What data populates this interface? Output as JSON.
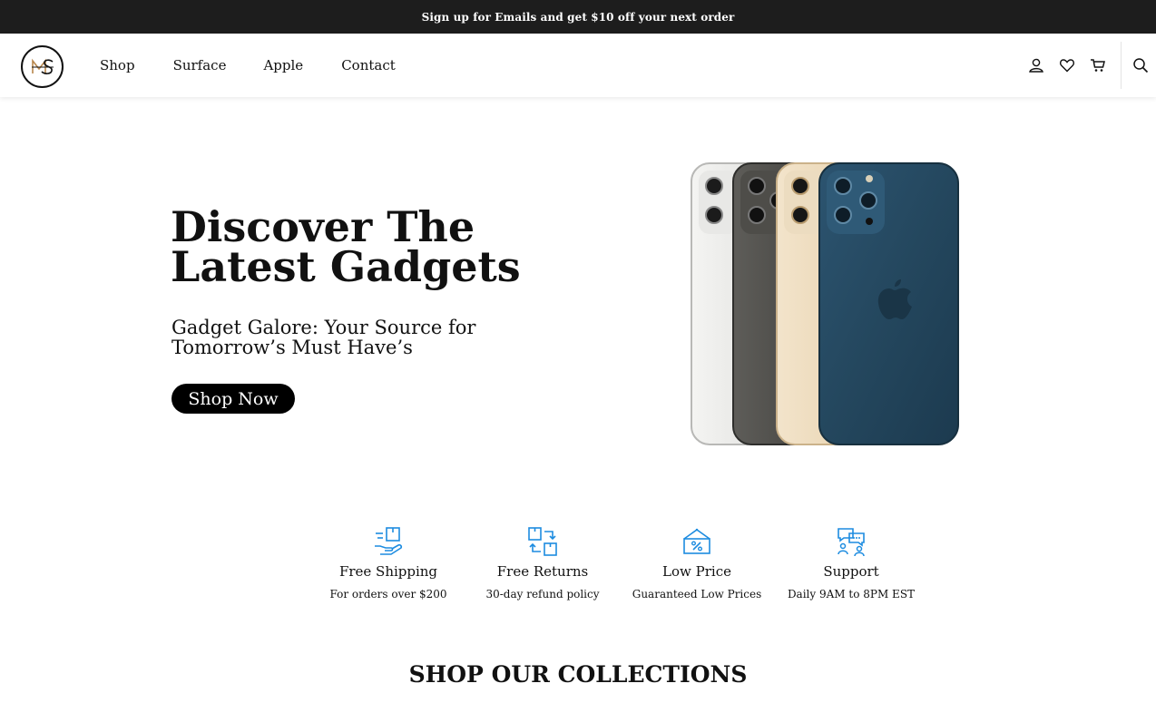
{
  "announcement": "Sign up for Emails and get $10 off your next order",
  "logo": {
    "letters": "MS",
    "accent": "#b8864b"
  },
  "nav": [
    "Shop",
    "Surface",
    "Apple",
    "Contact"
  ],
  "header_icons": [
    "account-icon",
    "wishlist-heart-icon",
    "cart-icon",
    "search-icon"
  ],
  "hero": {
    "title": "Discover The Latest Gadgets",
    "subtitle": "Gadget Galore: Your Source for Tomorrow’s Must Have’s",
    "cta": "Shop Now"
  },
  "features": [
    {
      "icon": "hand-box-icon",
      "title": "Free Shipping",
      "desc": "For orders over $200"
    },
    {
      "icon": "exchange-boxes-icon",
      "title": "Free Returns",
      "desc": "30-day refund policy"
    },
    {
      "icon": "percent-tag-icon",
      "title": "Low Price",
      "desc": "Guaranteed Low Prices"
    },
    {
      "icon": "chat-support-icon",
      "title": "Support",
      "desc": "Daily 9AM to 8PM EST"
    }
  ],
  "feature_icon_color": "#1d8ce0",
  "collections_heading": "SHOP OUR COLLECTIONS"
}
